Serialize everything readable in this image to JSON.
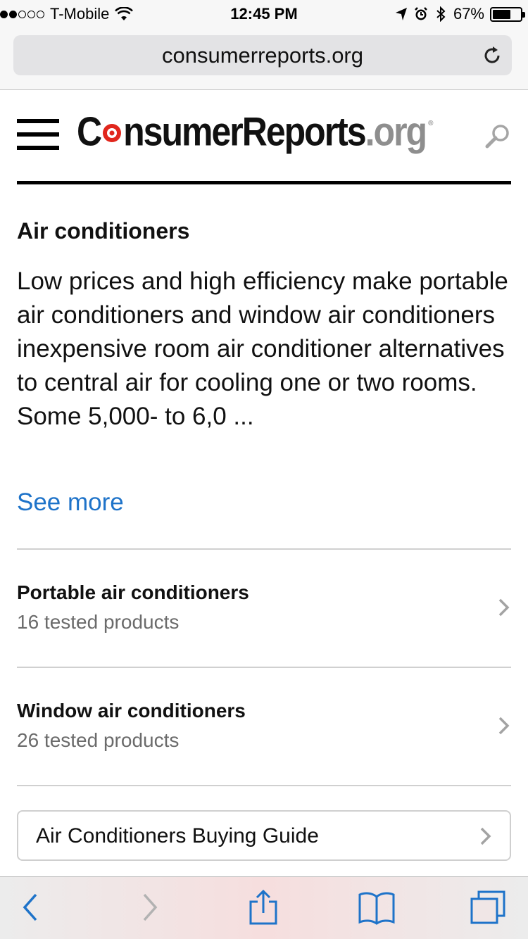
{
  "status_bar": {
    "carrier": "T-Mobile",
    "time": "12:45 PM",
    "battery": "67%",
    "battery_level": 0.67,
    "signal_bars_filled": 2,
    "signal_bars_total": 5,
    "icons": [
      "wifi-icon",
      "location-arrow-icon",
      "alarm-icon",
      "bluetooth-icon",
      "battery-icon"
    ]
  },
  "browser": {
    "url": "consumerreports.org",
    "reload_icon": "reload-icon"
  },
  "site": {
    "logo_main_before": "C",
    "logo_main_after": "nsumerReports",
    "logo_org": ".org",
    "logo_reg": "®",
    "logo_accent": "#e1261c",
    "menu_icon": "hamburger-menu-icon",
    "search_icon": "search-icon"
  },
  "article": {
    "title": "Air conditioners",
    "description": "Low prices and high efficiency make portable air conditioners and window air conditioners inexpensive room air conditioner alternatives to central air for cooling one or two rooms. Some 5,000- to 6,0 ...",
    "see_more": "See more",
    "link_color": "#1e73c9"
  },
  "categories": [
    {
      "name": "Portable air conditioners",
      "count": "16 tested products"
    },
    {
      "name": "Window air conditioners",
      "count": "26 tested products"
    }
  ],
  "buying_guide": {
    "label": "Air Conditioners Buying Guide"
  },
  "toolbar": {
    "icons": [
      "back-icon",
      "forward-icon",
      "share-icon",
      "bookmarks-icon",
      "tabs-icon"
    ],
    "accent": "#1e73c9"
  }
}
